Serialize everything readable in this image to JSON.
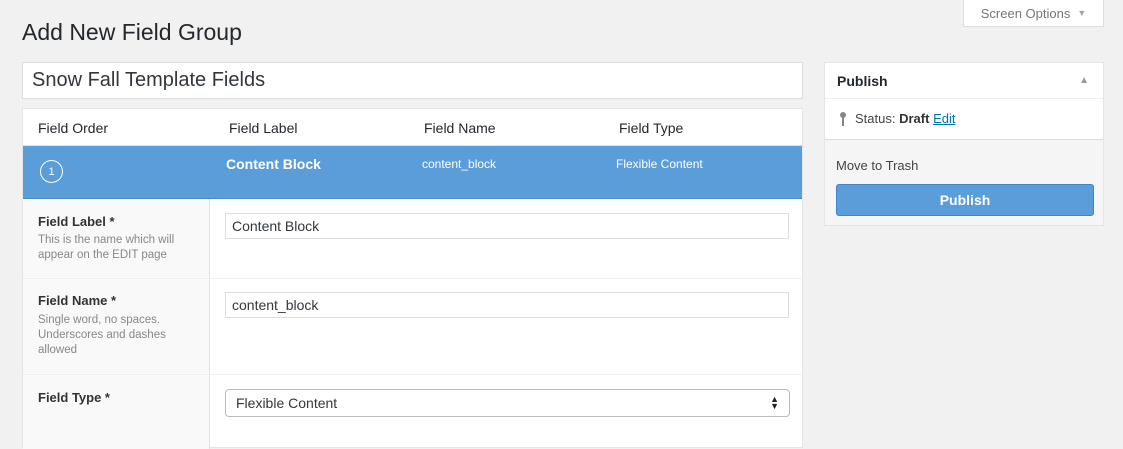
{
  "page": {
    "title": "Add New Field Group"
  },
  "screen_options": {
    "label": "Screen Options"
  },
  "title_field": {
    "value": "Snow Fall Template Fields"
  },
  "fields_table": {
    "headers": [
      "Field Order",
      "Field Label",
      "Field Name",
      "Field Type"
    ],
    "active_field": {
      "order": "1",
      "label": "Content Block",
      "name": "content_block",
      "type": "Flexible Content"
    }
  },
  "field_settings": {
    "label": {
      "title": "Field Label *",
      "description": "This is the name which will appear on the EDIT page",
      "value": "Content Block"
    },
    "name": {
      "title": "Field Name *",
      "description": "Single word, no spaces. Underscores and dashes allowed",
      "value": "content_block"
    },
    "type": {
      "title": "Field Type *",
      "selected": "Flexible Content"
    }
  },
  "publish": {
    "title": "Publish",
    "status_label": "Status:",
    "status_value": "Draft",
    "edit_link": "Edit",
    "trash_link": "Move to Trash",
    "button_label": "Publish"
  },
  "colors": {
    "accent": "#5b9dd9",
    "link": "#0073aa",
    "background": "#f1f1f1"
  }
}
